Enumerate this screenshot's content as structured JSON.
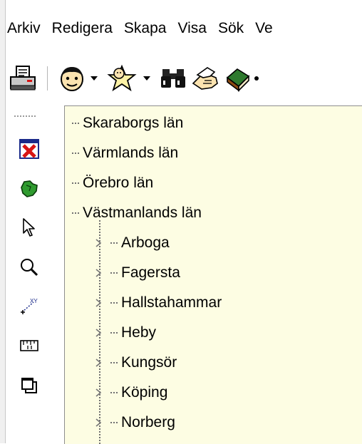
{
  "menu": {
    "items": [
      {
        "label": "Arkiv"
      },
      {
        "label": "Redigera"
      },
      {
        "label": "Skapa"
      },
      {
        "label": "Visa"
      },
      {
        "label": "Sök"
      },
      {
        "label": "Ve"
      }
    ]
  },
  "toolbar": {
    "buttons": [
      {
        "icon": "printer-icon"
      },
      {
        "icon": "person-icon"
      },
      {
        "icon": "person-star-icon"
      },
      {
        "icon": "binoculars-icon"
      },
      {
        "icon": "handshake-icon"
      },
      {
        "icon": "book-icon"
      }
    ]
  },
  "vtoolbar": {
    "buttons": [
      {
        "icon": "close-x-icon"
      },
      {
        "icon": "map-region-icon"
      },
      {
        "icon": "pointer-icon"
      },
      {
        "icon": "magnifier-icon"
      },
      {
        "icon": "coordinate-xy-icon"
      },
      {
        "icon": "ruler-icon"
      },
      {
        "icon": "copy-windows-icon"
      }
    ]
  },
  "tree": {
    "top_level": [
      {
        "label": "Skaraborgs län"
      },
      {
        "label": "Värmlands län"
      },
      {
        "label": "Örebro län"
      },
      {
        "label": "Västmanlands län"
      }
    ],
    "children": [
      {
        "label": "Arboga"
      },
      {
        "label": "Fagersta"
      },
      {
        "label": "Hallstahammar"
      },
      {
        "label": "Heby"
      },
      {
        "label": "Kungsör"
      },
      {
        "label": "Köping"
      },
      {
        "label": "Norberg"
      }
    ]
  },
  "colors": {
    "tree_background": "#fdfde3",
    "close_red": "#d81414",
    "region_green": "#2f9b2f"
  }
}
